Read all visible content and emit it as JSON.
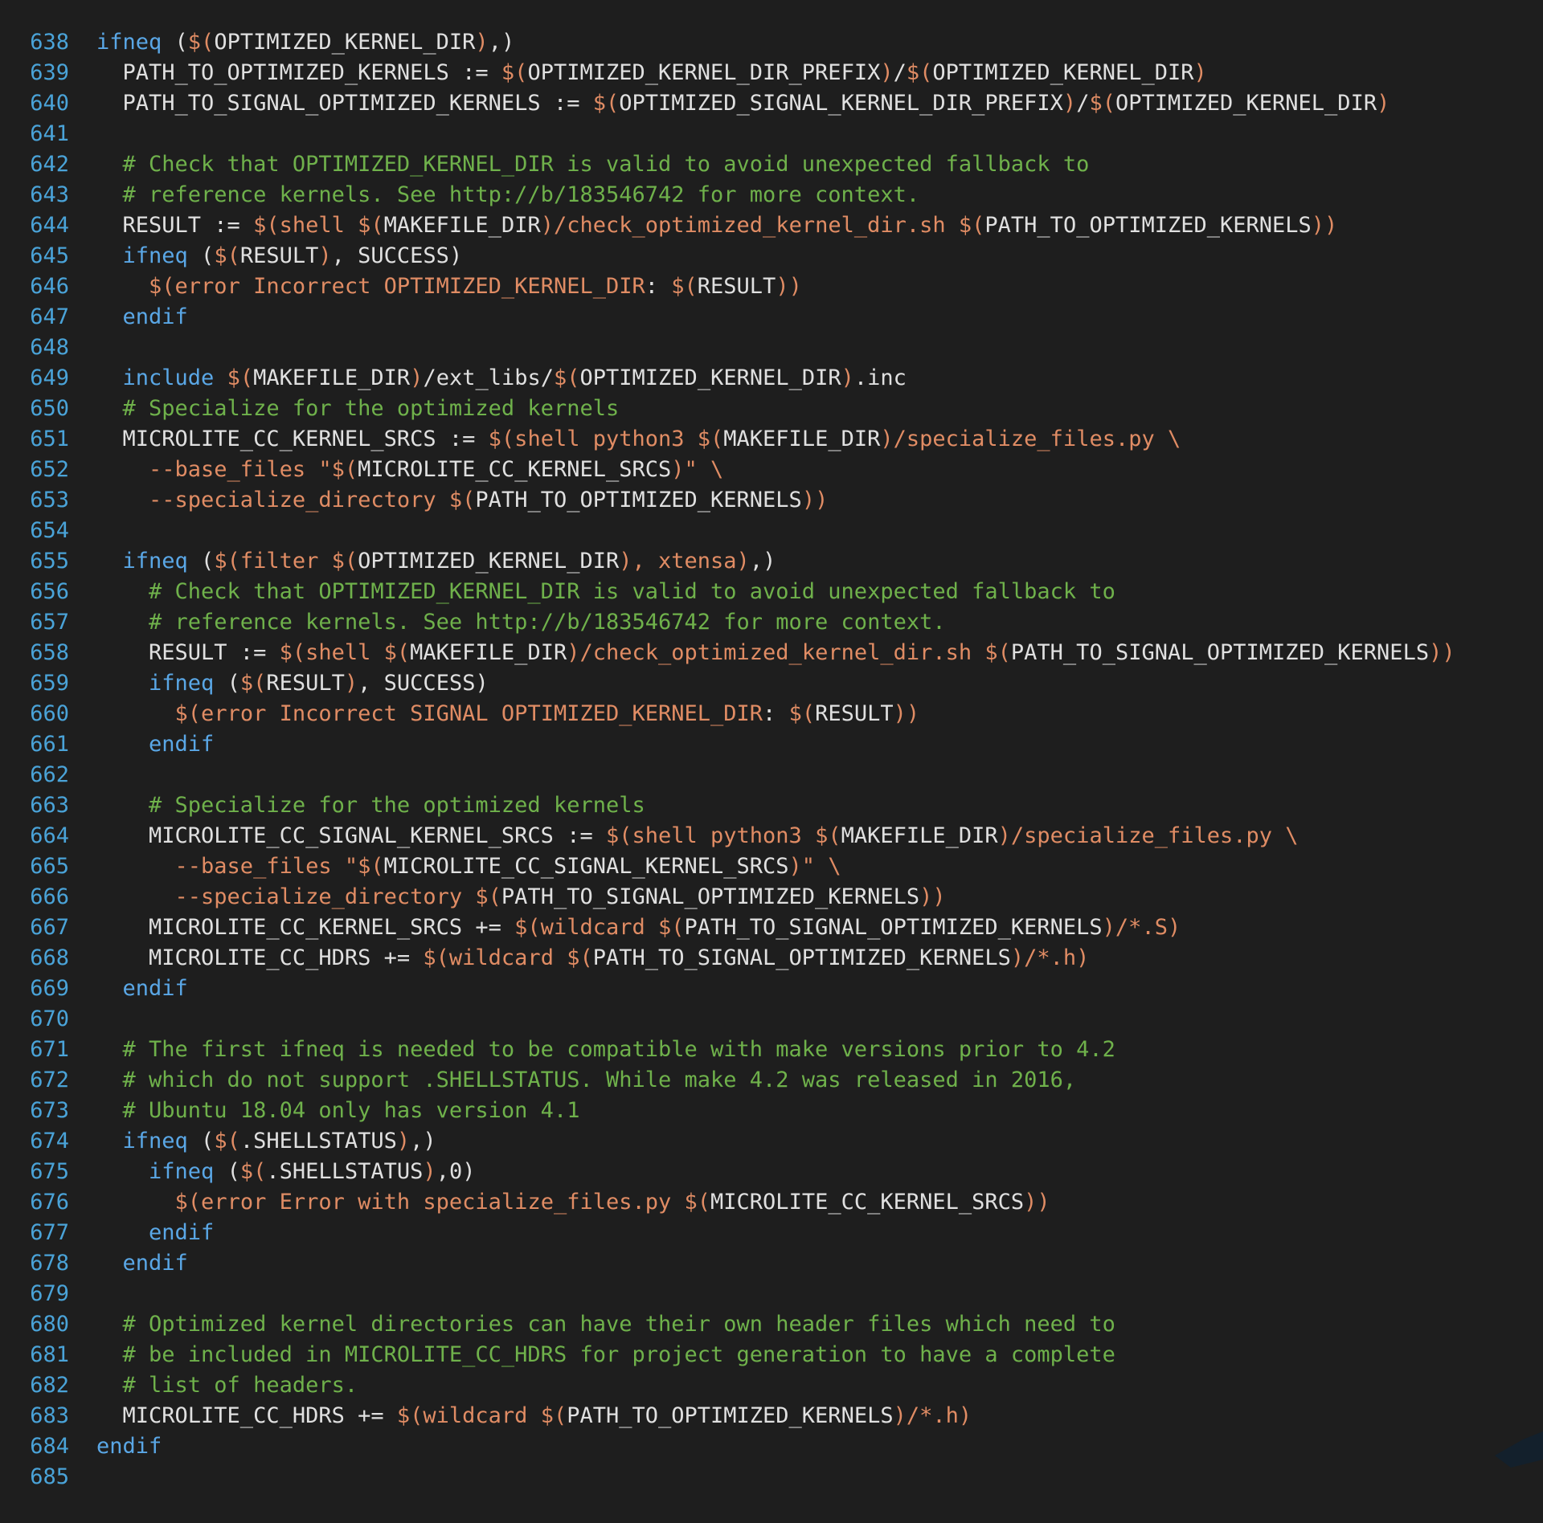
{
  "editor": {
    "language": "makefile",
    "colors": {
      "background": "#1e1e1e",
      "line_number": "#4aa3d8",
      "keyword": "#5aa7e6",
      "variable": "#e0e0e0",
      "function": "#e08c64",
      "comment": "#6fb14b"
    },
    "lines": [
      {
        "n": "638",
        "tokens": [
          [
            "keyword",
            "ifneq"
          ],
          [
            "plain",
            " ("
          ],
          [
            "fn",
            "$("
          ],
          [
            "variable",
            "OPTIMIZED_KERNEL_DIR"
          ],
          [
            "fn",
            ")"
          ],
          [
            "plain",
            ",)"
          ]
        ]
      },
      {
        "n": "639",
        "tokens": [
          [
            "plain",
            "  PATH_TO_OPTIMIZED_KERNELS := "
          ],
          [
            "fn",
            "$("
          ],
          [
            "variable",
            "OPTIMIZED_KERNEL_DIR_PREFIX"
          ],
          [
            "fn",
            ")"
          ],
          [
            "plain",
            "/"
          ],
          [
            "fn",
            "$("
          ],
          [
            "variable",
            "OPTIMIZED_KERNEL_DIR"
          ],
          [
            "fn",
            ")"
          ]
        ]
      },
      {
        "n": "640",
        "tokens": [
          [
            "plain",
            "  PATH_TO_SIGNAL_OPTIMIZED_KERNELS := "
          ],
          [
            "fn",
            "$("
          ],
          [
            "variable",
            "OPTIMIZED_SIGNAL_KERNEL_DIR_PREFIX"
          ],
          [
            "fn",
            ")"
          ],
          [
            "plain",
            "/"
          ],
          [
            "fn",
            "$("
          ],
          [
            "variable",
            "OPTIMIZED_KERNEL_DIR"
          ],
          [
            "fn",
            ")"
          ]
        ]
      },
      {
        "n": "641",
        "tokens": []
      },
      {
        "n": "642",
        "tokens": [
          [
            "comment",
            "  # Check that OPTIMIZED_KERNEL_DIR is valid to avoid unexpected fallback to"
          ]
        ]
      },
      {
        "n": "643",
        "tokens": [
          [
            "comment",
            "  # reference kernels. See http://b/183546742 for more context."
          ]
        ]
      },
      {
        "n": "644",
        "tokens": [
          [
            "plain",
            "  RESULT := "
          ],
          [
            "fn",
            "$(shell "
          ],
          [
            "fn",
            "$("
          ],
          [
            "variable",
            "MAKEFILE_DIR"
          ],
          [
            "fn",
            ")/check_optimized_kernel_dir.sh "
          ],
          [
            "fn",
            "$("
          ],
          [
            "variable",
            "PATH_TO_OPTIMIZED_KERNELS"
          ],
          [
            "fn",
            "))"
          ]
        ]
      },
      {
        "n": "645",
        "tokens": [
          [
            "plain",
            "  "
          ],
          [
            "keyword",
            "ifneq"
          ],
          [
            "plain",
            " ("
          ],
          [
            "fn",
            "$("
          ],
          [
            "variable",
            "RESULT"
          ],
          [
            "fn",
            ")"
          ],
          [
            "plain",
            ", SUCCESS)"
          ]
        ]
      },
      {
        "n": "646",
        "tokens": [
          [
            "plain",
            "    "
          ],
          [
            "fn",
            "$(error Incorrect OPTIMIZED_KERNEL_DIR"
          ],
          [
            "plain",
            ": "
          ],
          [
            "fn",
            "$("
          ],
          [
            "variable",
            "RESULT"
          ],
          [
            "fn",
            "))"
          ]
        ]
      },
      {
        "n": "647",
        "tokens": [
          [
            "plain",
            "  "
          ],
          [
            "keyword",
            "endif"
          ]
        ]
      },
      {
        "n": "648",
        "tokens": []
      },
      {
        "n": "649",
        "tokens": [
          [
            "plain",
            "  "
          ],
          [
            "keyword",
            "include"
          ],
          [
            "plain",
            " "
          ],
          [
            "fn",
            "$("
          ],
          [
            "variable",
            "MAKEFILE_DIR"
          ],
          [
            "fn",
            ")"
          ],
          [
            "plain",
            "/ext_libs/"
          ],
          [
            "fn",
            "$("
          ],
          [
            "variable",
            "OPTIMIZED_KERNEL_DIR"
          ],
          [
            "fn",
            ")"
          ],
          [
            "plain",
            ".inc"
          ]
        ]
      },
      {
        "n": "650",
        "tokens": [
          [
            "comment",
            "  # Specialize for the optimized kernels"
          ]
        ]
      },
      {
        "n": "651",
        "tokens": [
          [
            "plain",
            "  MICROLITE_CC_KERNEL_SRCS := "
          ],
          [
            "fn",
            "$(shell python3 "
          ],
          [
            "fn",
            "$("
          ],
          [
            "variable",
            "MAKEFILE_DIR"
          ],
          [
            "fn",
            ")/specialize_files.py \\"
          ]
        ]
      },
      {
        "n": "652",
        "tokens": [
          [
            "fn",
            "    --base_files \""
          ],
          [
            "fn",
            "$("
          ],
          [
            "variable",
            "MICROLITE_CC_KERNEL_SRCS"
          ],
          [
            "fn",
            ")\" \\"
          ]
        ]
      },
      {
        "n": "653",
        "tokens": [
          [
            "fn",
            "    --specialize_directory "
          ],
          [
            "fn",
            "$("
          ],
          [
            "variable",
            "PATH_TO_OPTIMIZED_KERNELS"
          ],
          [
            "fn",
            "))"
          ]
        ]
      },
      {
        "n": "654",
        "tokens": []
      },
      {
        "n": "655",
        "tokens": [
          [
            "plain",
            "  "
          ],
          [
            "keyword",
            "ifneq"
          ],
          [
            "plain",
            " ("
          ],
          [
            "fn",
            "$(filter "
          ],
          [
            "fn",
            "$("
          ],
          [
            "variable",
            "OPTIMIZED_KERNEL_DIR"
          ],
          [
            "fn",
            "), xtensa)"
          ],
          [
            "plain",
            ",)"
          ]
        ]
      },
      {
        "n": "656",
        "tokens": [
          [
            "comment",
            "    # Check that OPTIMIZED_KERNEL_DIR is valid to avoid unexpected fallback to"
          ]
        ]
      },
      {
        "n": "657",
        "tokens": [
          [
            "comment",
            "    # reference kernels. See http://b/183546742 for more context."
          ]
        ]
      },
      {
        "n": "658",
        "tokens": [
          [
            "plain",
            "    RESULT := "
          ],
          [
            "fn",
            "$(shell "
          ],
          [
            "fn",
            "$("
          ],
          [
            "variable",
            "MAKEFILE_DIR"
          ],
          [
            "fn",
            ")/check_optimized_kernel_dir.sh "
          ],
          [
            "fn",
            "$("
          ],
          [
            "variable",
            "PATH_TO_SIGNAL_OPTIMIZED_KERNELS"
          ],
          [
            "fn",
            "))"
          ]
        ]
      },
      {
        "n": "659",
        "tokens": [
          [
            "plain",
            "    "
          ],
          [
            "keyword",
            "ifneq"
          ],
          [
            "plain",
            " ("
          ],
          [
            "fn",
            "$("
          ],
          [
            "variable",
            "RESULT"
          ],
          [
            "fn",
            ")"
          ],
          [
            "plain",
            ", SUCCESS)"
          ]
        ]
      },
      {
        "n": "660",
        "tokens": [
          [
            "plain",
            "      "
          ],
          [
            "fn",
            "$(error Incorrect SIGNAL OPTIMIZED_KERNEL_DIR"
          ],
          [
            "plain",
            ": "
          ],
          [
            "fn",
            "$("
          ],
          [
            "variable",
            "RESULT"
          ],
          [
            "fn",
            "))"
          ]
        ]
      },
      {
        "n": "661",
        "tokens": [
          [
            "plain",
            "    "
          ],
          [
            "keyword",
            "endif"
          ]
        ]
      },
      {
        "n": "662",
        "tokens": []
      },
      {
        "n": "663",
        "tokens": [
          [
            "comment",
            "    # Specialize for the optimized kernels"
          ]
        ]
      },
      {
        "n": "664",
        "tokens": [
          [
            "plain",
            "    MICROLITE_CC_SIGNAL_KERNEL_SRCS := "
          ],
          [
            "fn",
            "$(shell python3 "
          ],
          [
            "fn",
            "$("
          ],
          [
            "variable",
            "MAKEFILE_DIR"
          ],
          [
            "fn",
            ")/specialize_files.py \\"
          ]
        ]
      },
      {
        "n": "665",
        "tokens": [
          [
            "fn",
            "      --base_files \""
          ],
          [
            "fn",
            "$("
          ],
          [
            "variable",
            "MICROLITE_CC_SIGNAL_KERNEL_SRCS"
          ],
          [
            "fn",
            ")\" \\"
          ]
        ]
      },
      {
        "n": "666",
        "tokens": [
          [
            "fn",
            "      --specialize_directory "
          ],
          [
            "fn",
            "$("
          ],
          [
            "variable",
            "PATH_TO_SIGNAL_OPTIMIZED_KERNELS"
          ],
          [
            "fn",
            "))"
          ]
        ]
      },
      {
        "n": "667",
        "tokens": [
          [
            "plain",
            "    MICROLITE_CC_KERNEL_SRCS += "
          ],
          [
            "fn",
            "$(wildcard "
          ],
          [
            "fn",
            "$("
          ],
          [
            "variable",
            "PATH_TO_SIGNAL_OPTIMIZED_KERNELS"
          ],
          [
            "fn",
            ")/*.S)"
          ]
        ]
      },
      {
        "n": "668",
        "tokens": [
          [
            "plain",
            "    MICROLITE_CC_HDRS += "
          ],
          [
            "fn",
            "$(wildcard "
          ],
          [
            "fn",
            "$("
          ],
          [
            "variable",
            "PATH_TO_SIGNAL_OPTIMIZED_KERNELS"
          ],
          [
            "fn",
            ")/*.h)"
          ]
        ]
      },
      {
        "n": "669",
        "tokens": [
          [
            "plain",
            "  "
          ],
          [
            "keyword",
            "endif"
          ]
        ]
      },
      {
        "n": "670",
        "tokens": []
      },
      {
        "n": "671",
        "tokens": [
          [
            "comment",
            "  # The first ifneq is needed to be compatible with make versions prior to 4.2"
          ]
        ]
      },
      {
        "n": "672",
        "tokens": [
          [
            "comment",
            "  # which do not support .SHELLSTATUS. While make 4.2 was released in 2016,"
          ]
        ]
      },
      {
        "n": "673",
        "tokens": [
          [
            "comment",
            "  # Ubuntu 18.04 only has version 4.1"
          ]
        ]
      },
      {
        "n": "674",
        "tokens": [
          [
            "plain",
            "  "
          ],
          [
            "keyword",
            "ifneq"
          ],
          [
            "plain",
            " ("
          ],
          [
            "fn",
            "$("
          ],
          [
            "variable",
            ".SHELLSTATUS"
          ],
          [
            "fn",
            ")"
          ],
          [
            "plain",
            ",)"
          ]
        ]
      },
      {
        "n": "675",
        "tokens": [
          [
            "plain",
            "    "
          ],
          [
            "keyword",
            "ifneq"
          ],
          [
            "plain",
            " ("
          ],
          [
            "fn",
            "$("
          ],
          [
            "variable",
            ".SHELLSTATUS"
          ],
          [
            "fn",
            ")"
          ],
          [
            "plain",
            ",0)"
          ]
        ]
      },
      {
        "n": "676",
        "tokens": [
          [
            "plain",
            "      "
          ],
          [
            "fn",
            "$(error Error with specialize_files.py "
          ],
          [
            "fn",
            "$("
          ],
          [
            "variable",
            "MICROLITE_CC_KERNEL_SRCS"
          ],
          [
            "fn",
            "))"
          ]
        ]
      },
      {
        "n": "677",
        "tokens": [
          [
            "plain",
            "    "
          ],
          [
            "keyword",
            "endif"
          ]
        ]
      },
      {
        "n": "678",
        "tokens": [
          [
            "plain",
            "  "
          ],
          [
            "keyword",
            "endif"
          ]
        ]
      },
      {
        "n": "679",
        "tokens": []
      },
      {
        "n": "680",
        "tokens": [
          [
            "comment",
            "  # Optimized kernel directories can have their own header files which need to"
          ]
        ]
      },
      {
        "n": "681",
        "tokens": [
          [
            "comment",
            "  # be included in MICROLITE_CC_HDRS for project generation to have a complete"
          ]
        ]
      },
      {
        "n": "682",
        "tokens": [
          [
            "comment",
            "  # list of headers."
          ]
        ]
      },
      {
        "n": "683",
        "tokens": [
          [
            "plain",
            "  MICROLITE_CC_HDRS += "
          ],
          [
            "fn",
            "$(wildcard "
          ],
          [
            "fn",
            "$("
          ],
          [
            "variable",
            "PATH_TO_OPTIMIZED_KERNELS"
          ],
          [
            "fn",
            ")/*.h)"
          ]
        ]
      },
      {
        "n": "684",
        "tokens": [
          [
            "keyword",
            "endif"
          ]
        ]
      },
      {
        "n": "685",
        "tokens": []
      }
    ]
  }
}
